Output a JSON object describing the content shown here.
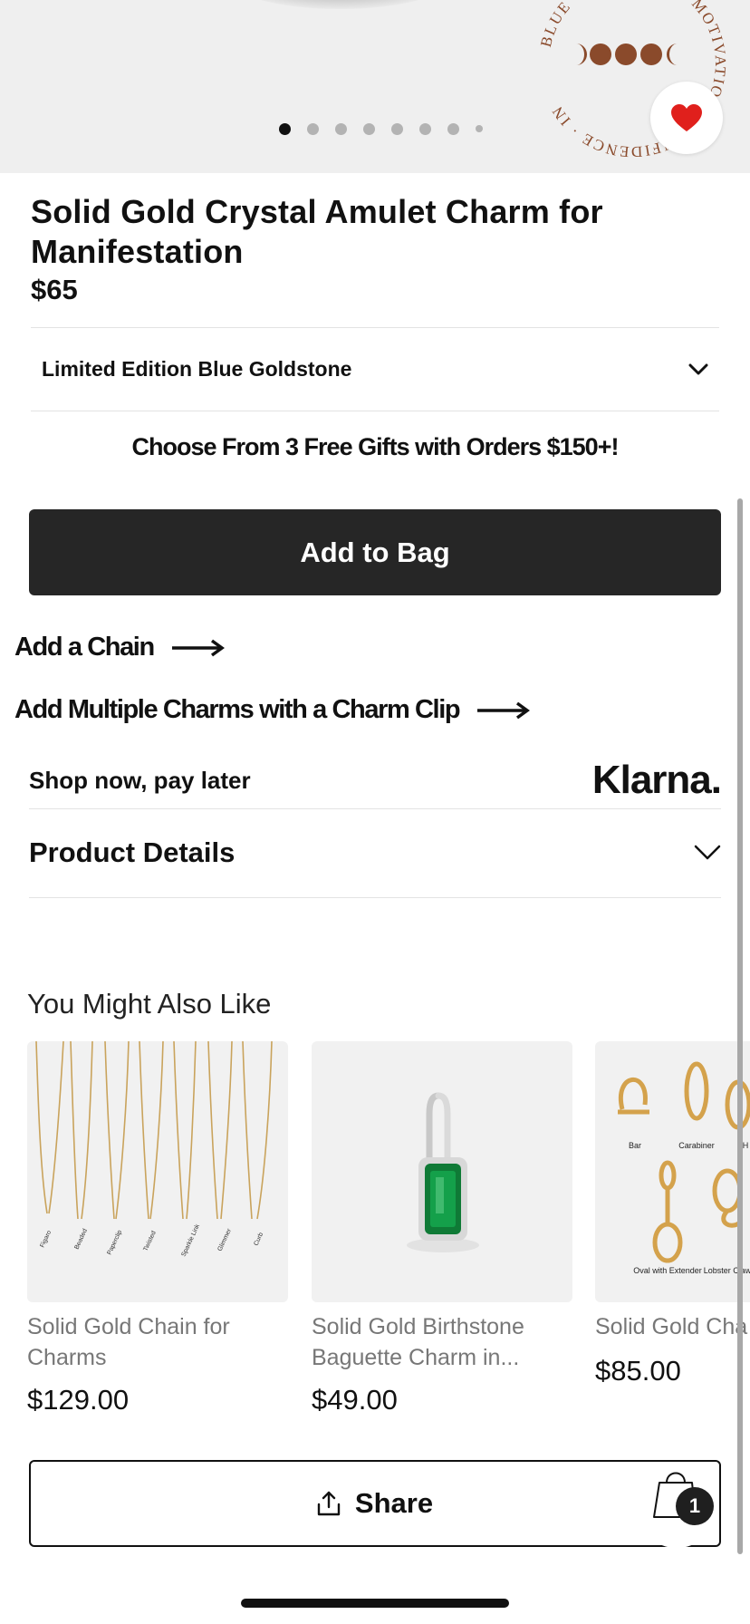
{
  "hero": {
    "seal_text": "BLUE GOLDSTONE · MOTIVATION · CONFIDENCE · IN",
    "dot_count": 8,
    "active_dot": 0
  },
  "product": {
    "title": "Solid Gold Crystal Amulet Charm for Manifestation",
    "price": "$65",
    "variant": "Limited Edition Blue Goldstone"
  },
  "promo": "Choose From 3 Free Gifts with Orders $150+!",
  "add_to_bag": "Add to Bag",
  "links": {
    "add_chain": "Add a Chain",
    "add_multiple": "Add Multiple Charms with a Charm Clip"
  },
  "klarna": {
    "text": "Shop now, pay later",
    "logo": "Klarna."
  },
  "details": {
    "label": "Product Details"
  },
  "recommendations": {
    "heading": "You Might Also Like",
    "items": [
      {
        "name": "Solid Gold Chain for Charms",
        "price": "$129.00",
        "chain_labels": [
          "Figaro",
          "Beaded",
          "Paperclip",
          "Twisted",
          "Sparkle Link",
          "Glimmer",
          "Curb"
        ]
      },
      {
        "name": "Solid Gold Birthstone Baguette Charm in...",
        "price": "$49.00"
      },
      {
        "name": "Solid Gold Cha",
        "price": "$85.00",
        "clip_labels": {
          "bar": "Bar",
          "carabiner": "Carabiner",
          "h": "H",
          "oval": "Oval with Extender",
          "lobster": "Lobster Claw"
        }
      }
    ]
  },
  "share": {
    "label": "Share"
  },
  "bag": {
    "count": "1"
  },
  "colors": {
    "heart": "#e0201c",
    "seal_brown": "#8a4a2b",
    "button_dark": "#262626",
    "emerald": "#0f7a36"
  }
}
